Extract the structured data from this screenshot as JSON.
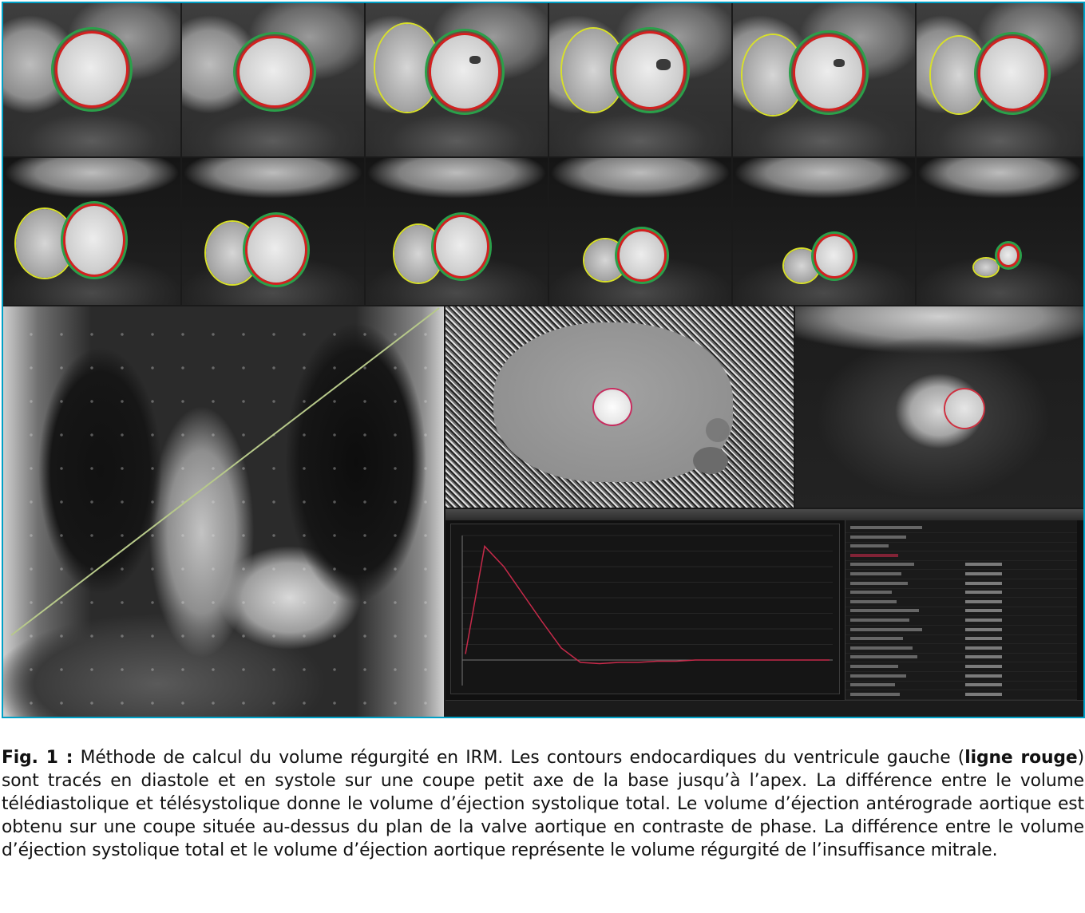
{
  "caption": {
    "label": "Fig. 1 :",
    "part1": " Méthode de calcul du volume régurgité en IRM. Les contours endocardiques du ventricule gauche (",
    "bold": "ligne rouge",
    "part2": ") sont tracés en diastole et en systole sur une coupe petit axe de la base jusqu’à l’apex. La différence entre le volume télédiastolique et télésystolique donne le volume d’éjection systolique total. Le volume d’éjection antérograde aortique est obtenu sur une coupe située au-dessus du plan de la valve aortique en contraste de phase. La différence entre le volume d’éjection systolique total et le volume d’éjection aortique représente le volume régurgité de l’insuffisance mitrale."
  },
  "colors": {
    "frame_border": "#00a0c6",
    "endocardial_contour": "#d41f1f",
    "epicardial_contour": "#2aa04a",
    "rv_contour": "#d8e02a",
    "flow_curve": "#c62a4a"
  },
  "flow_panel": {
    "curve_shape": [
      0.05,
      0.95,
      0.78,
      0.55,
      0.32,
      0.1,
      -0.02,
      -0.03,
      -0.02,
      -0.02,
      -0.01,
      -0.01,
      0,
      0,
      0,
      0,
      0,
      0,
      0,
      0
    ]
  }
}
